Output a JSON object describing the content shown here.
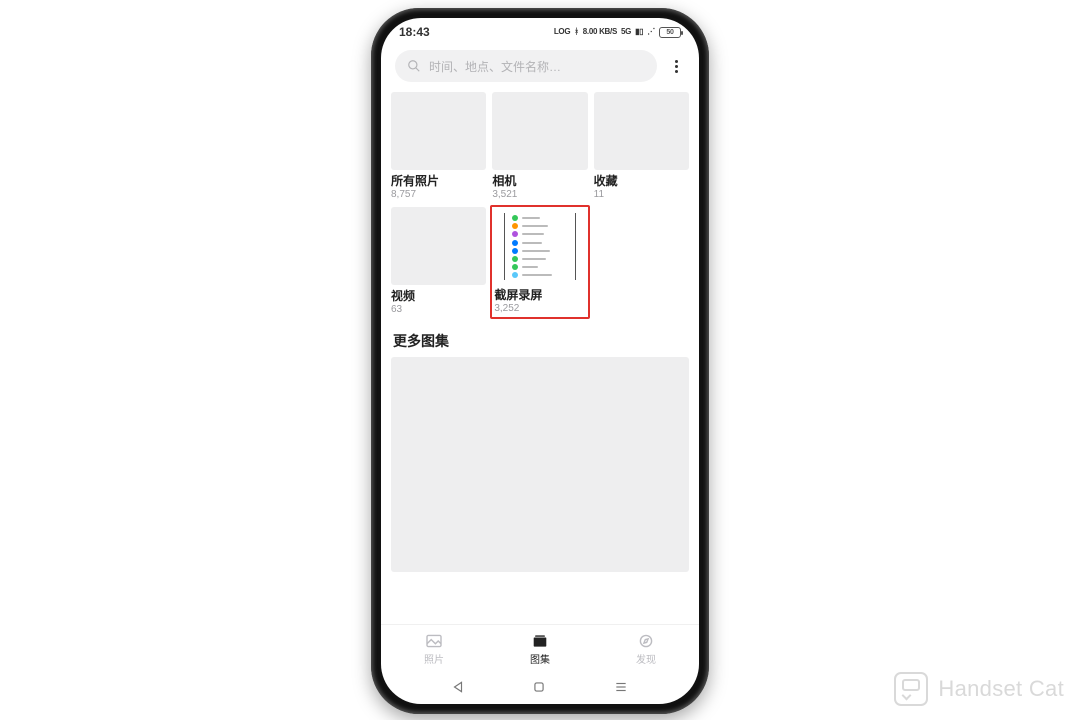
{
  "statusbar": {
    "time": "18:43",
    "net_label": "8.00 KB/S",
    "signal_label": "5G",
    "band_label": "LOG",
    "battery_pct": "50"
  },
  "search": {
    "placeholder": "时间、地点、文件名称…"
  },
  "albums_row1": [
    {
      "title": "所有照片",
      "count": "8,757"
    },
    {
      "title": "相机",
      "count": "3,521"
    },
    {
      "title": "收藏",
      "count": "11"
    }
  ],
  "albums_row2": [
    {
      "title": "视频",
      "count": "63"
    },
    {
      "title": "截屏录屏",
      "count": "3,252"
    }
  ],
  "section_more": "更多图集",
  "tabs": {
    "photos": "照片",
    "albums": "图集",
    "discover": "发现"
  },
  "watermark": "Handset Cat",
  "mini_colors": [
    "#34c759",
    "#ff9500",
    "#af52de",
    "#007aff",
    "#007aff",
    "#34c759",
    "#34c759",
    "#5ac8fa"
  ]
}
